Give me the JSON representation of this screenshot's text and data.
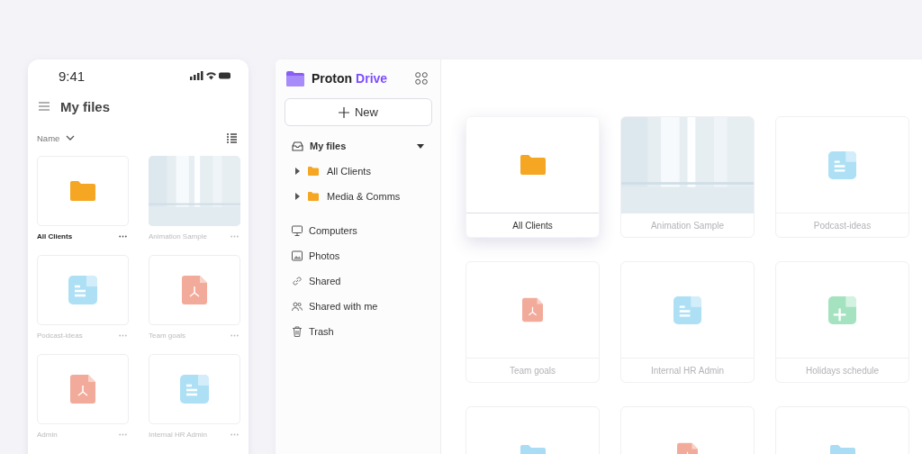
{
  "phone": {
    "time": "9:41",
    "title": "My files",
    "sort": "Name",
    "files": [
      {
        "name": "All Clients",
        "kind": "folder",
        "color": "#f5a623",
        "selected": true
      },
      {
        "name": "Animation Sample",
        "kind": "picture",
        "selected": false
      },
      {
        "name": "Podcast-ideas",
        "kind": "doc",
        "selected": false
      },
      {
        "name": "Team goals",
        "kind": "pdf",
        "selected": false
      },
      {
        "name": "Admin",
        "kind": "pdf",
        "selected": false
      },
      {
        "name": "Internal HR Admin",
        "kind": "doc",
        "selected": false
      }
    ]
  },
  "sidebar": {
    "brand": "Proton",
    "product": "Drive",
    "new_button": "New",
    "tree": {
      "label": "My files",
      "expanded": true,
      "children": [
        {
          "label": "All Clients",
          "expanded": false
        },
        {
          "label": "Media & Comms",
          "expanded": false
        }
      ]
    },
    "items": [
      {
        "label": "Computers",
        "kind": "computer"
      },
      {
        "label": "Photos"
      },
      {
        "label": "Shared",
        "kind": "link"
      },
      {
        "label": "Shared with me",
        "kind": "people"
      },
      {
        "label": "Trash",
        "kind": "trash"
      }
    ]
  },
  "grid": {
    "files": [
      {
        "name": "All Clients",
        "kind": "folder",
        "color": "#f5a623",
        "selected": true
      },
      {
        "name": "Animation Sample",
        "kind": "picture",
        "selected": false
      },
      {
        "name": "Podcast-ideas",
        "kind": "doc",
        "selected": false
      },
      {
        "name": "Team goals",
        "kind": "pdf",
        "selected": false
      },
      {
        "name": "Internal HR Admin",
        "kind": "doc",
        "selected": false
      },
      {
        "name": "Holidays schedule",
        "kind": "sheet",
        "selected": false
      },
      {
        "kind": "folder",
        "color": "#a9dcf5",
        "selected": false
      },
      {
        "kind": "pdf",
        "selected": false
      },
      {
        "kind": "folder",
        "color": "#a9dcf5",
        "selected": false
      }
    ]
  }
}
